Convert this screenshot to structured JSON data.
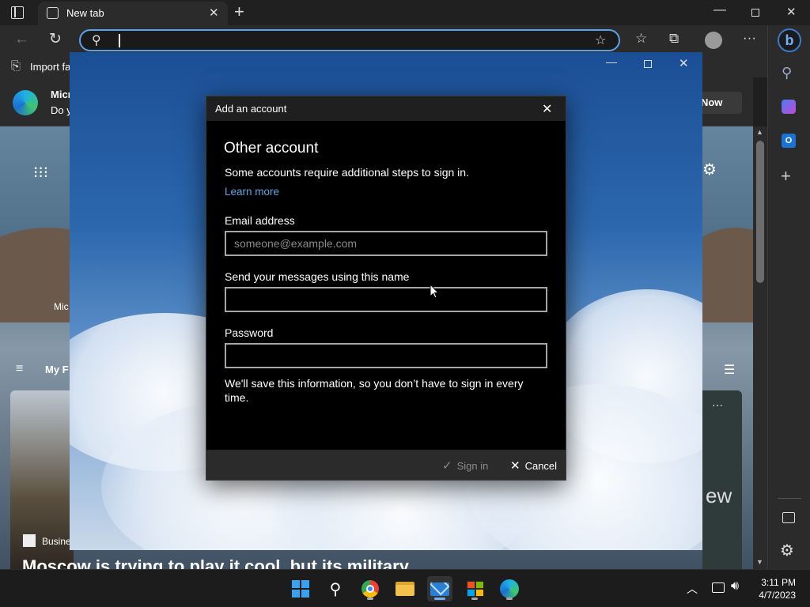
{
  "browser": {
    "tab_title": "New tab",
    "favorites_item": "Import fa",
    "infobar_title": "Micr",
    "infobar_sub": "Do y",
    "infobar_button": "t Now",
    "page_text_1": "Mic",
    "page_text_2": "My F",
    "page_source": "Busine",
    "page_headline": "Moscow is trying to play it cool, but its military",
    "page_map_text": "ew"
  },
  "dialog": {
    "title": "Add an account",
    "heading": "Other account",
    "description": "Some accounts require additional steps to sign in.",
    "learn_more": "Learn more",
    "email_label": "Email address",
    "email_placeholder": "someone@example.com",
    "email_value": "",
    "name_label": "Send your messages using this name",
    "name_value": "",
    "password_label": "Password",
    "password_value": "",
    "note": "We'll save this information, so you don’t have to sign in every time.",
    "sign_in": "Sign in",
    "cancel": "Cancel"
  },
  "taskbar": {
    "time": "3:11 PM",
    "date": "4/7/2023"
  },
  "colors": {
    "accent": "#5aa3e8",
    "link": "#5ea6e6",
    "dialog_bg": "#000000"
  }
}
